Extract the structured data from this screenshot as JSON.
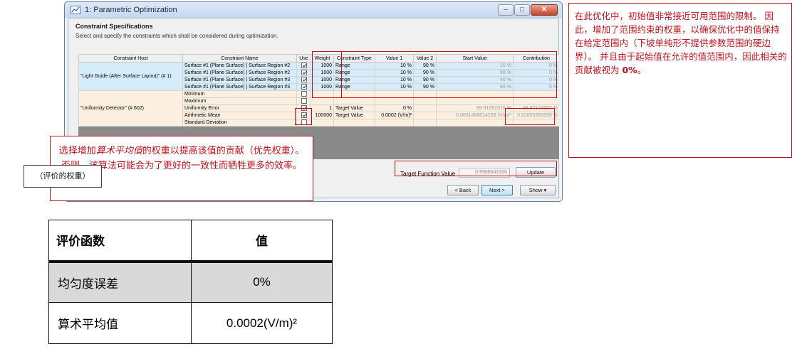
{
  "window": {
    "title": "1: Parametric Optimization",
    "section_title": "Constraint Specifications",
    "section_desc": "Select and specify the constraints which shall be considered during optimization."
  },
  "table": {
    "headers": [
      "Constraint Host",
      "Constraint Name",
      "Use",
      "Weight",
      "Constraint Type",
      "Value 1",
      "Value 2",
      "Start Value",
      "Contribution"
    ],
    "groups": [
      {
        "host": "\"Light Guide (After Surface Layout)\" (# 1)",
        "rows": [
          {
            "name": "Surface #1 (Plane Surface) | Surface Region #2",
            "use": true,
            "weight": "1000",
            "type": "Range",
            "v1": "10 %",
            "v2": "90 %",
            "start": "10 %",
            "contribution": "0 %"
          },
          {
            "name": "Surface #1 (Plane Surface) | Surface Region #2",
            "use": true,
            "weight": "1000",
            "type": "Range",
            "v1": "10 %",
            "v2": "90 %",
            "start": "50 %",
            "contribution": "0 %"
          },
          {
            "name": "Surface #1 (Plane Surface) | Surface Region #3",
            "use": true,
            "weight": "1000",
            "type": "Range",
            "v1": "10 %",
            "v2": "90 %",
            "start": "40 %",
            "contribution": "0 %"
          },
          {
            "name": "Surface #1 (Plane Surface) | Surface Region #3",
            "use": true,
            "weight": "1000",
            "type": "Range",
            "v1": "10 %",
            "v2": "90 %",
            "start": "90 %",
            "contribution": "0 %"
          }
        ]
      },
      {
        "host": "\"Uniformity Detector\" (# 602)",
        "rows": [
          {
            "name": "Minimum",
            "use": false,
            "weight": "",
            "type": "",
            "v1": "",
            "v2": "",
            "start": "",
            "contribution": ""
          },
          {
            "name": "Maximum",
            "use": false,
            "weight": "",
            "type": "",
            "v1": "",
            "v2": "",
            "start": "",
            "contribution": ""
          },
          {
            "name": "Uniformity Error",
            "use": true,
            "weight": "1",
            "type": "Target Value",
            "v1": "0 %",
            "v2": "",
            "start": "99.91592315 %",
            "contribution": "99.97144607 %"
          },
          {
            "name": "Arithmetic Mean",
            "use": true,
            "weight": "100000",
            "type": "Target Value",
            "v1": "0.0002 (V/m)²",
            "v2": "",
            "start": "0.0001466014283 (V/m)²",
            "contribution": "0.02855392699 %"
          },
          {
            "name": "Standard Deviation",
            "use": false,
            "weight": "",
            "type": "",
            "v1": "",
            "v2": "",
            "start": "",
            "contribution": ""
          }
        ]
      }
    ]
  },
  "bottom": {
    "tfv_label": "Target Function Value",
    "tfv_value": "0.9986043106",
    "update": "Update",
    "back": "< Back",
    "next": "Next >",
    "show": "Show ▾"
  },
  "callouts": {
    "right": "在此优化中，初始值非常接近可用范围的限制。 因此，增加了范围约束的权重，以确保优化中的值保持在给定范围内（下坡单纯形不提供参数范围的硬边界）。 并且由于起始值在允许的值范围内，因此相关的贡献被视为 ",
    "right_bold": "0%",
    "right_end": "。",
    "bottom_pre": "选择增加",
    "bottom_em": "算术平均值",
    "bottom_post": "的权重以提高该值的贡献（优先权重）。 否则，该算法可能会为了更好的一致性而牺牲更多的效率。",
    "weight_label": "（评价的权重）"
  },
  "summary": {
    "headers": [
      "评价函数",
      "值"
    ],
    "rows": [
      [
        "均匀度误差",
        "0%"
      ],
      [
        "算术平均值",
        "0.0002(V/m)²"
      ]
    ]
  }
}
